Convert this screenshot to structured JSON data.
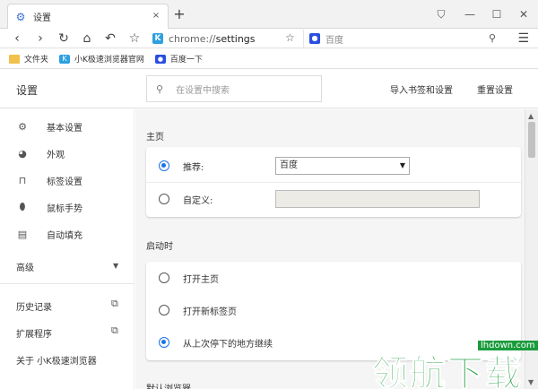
{
  "tab": {
    "title": "设置",
    "close": "×"
  },
  "newtab": "+",
  "window_controls": {
    "ext": "⛉",
    "minimize": "—",
    "maximize": "☐",
    "close": "✕"
  },
  "toolbar": {
    "back": "‹",
    "forward": "›",
    "reload": "↻",
    "home": "⌂",
    "undo": "↶",
    "bookmark_star": "☆",
    "url_scheme": "chrome://",
    "url_path": "settings",
    "star": "☆",
    "search_engine": "百度",
    "menu": "☰"
  },
  "bookmarks": [
    {
      "label": "文件夹",
      "icon": "folder-icon"
    },
    {
      "label": "小K极速浏览器官网",
      "icon": "k-logo-icon"
    },
    {
      "label": "百度一下",
      "icon": "baidu-paw-icon"
    }
  ],
  "settings": {
    "title": "设置",
    "search_placeholder": "在设置中搜索",
    "import_label": "导入书签和设置",
    "reset_label": "重置设置"
  },
  "sidebar": {
    "items": [
      {
        "label": "基本设置",
        "icon": "gear-icon"
      },
      {
        "label": "外观",
        "icon": "palette-icon"
      },
      {
        "label": "标签设置",
        "icon": "tab-icon"
      },
      {
        "label": "鼠标手势",
        "icon": "mouse-icon"
      },
      {
        "label": "自动填充",
        "icon": "clipboard-icon"
      }
    ],
    "advanced": "高级",
    "history": "历史记录",
    "extensions": "扩展程序",
    "about": "关于 小K极速浏览器"
  },
  "main": {
    "homepage": {
      "title": "主页",
      "recommended_label": "推荐:",
      "recommended_value": "百度",
      "custom_label": "自定义:"
    },
    "startup": {
      "title": "启动时",
      "options": [
        "打开主页",
        "打开新标签页",
        "从上次停下的地方继续"
      ],
      "selected_index": 2
    },
    "default_browser_title": "默认浏览器"
  },
  "watermark": {
    "url": "lhdown.com",
    "text": "领航下载"
  },
  "colors": {
    "accent": "#1a73e8",
    "watermark": "#1a9b3c"
  }
}
